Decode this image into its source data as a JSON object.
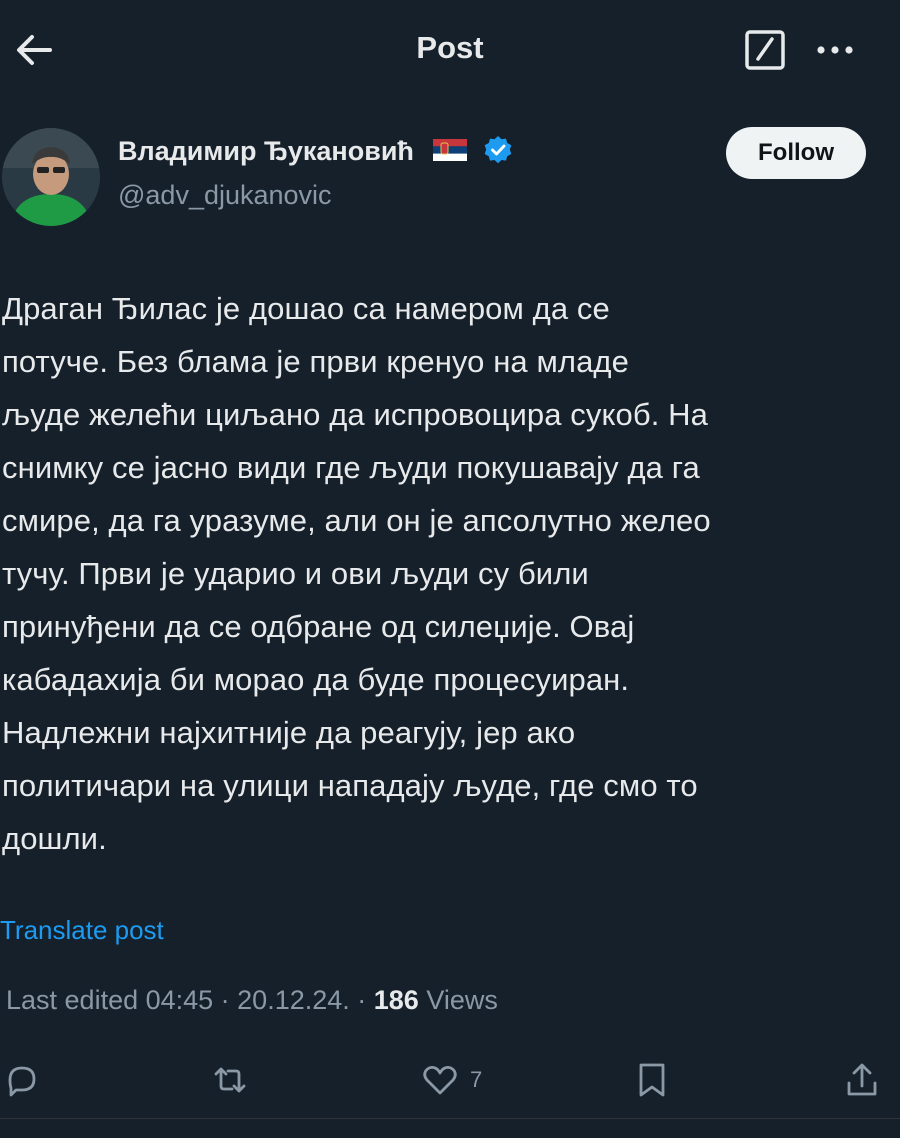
{
  "header": {
    "title": "Post"
  },
  "author": {
    "name": "Владимир Ђукановић",
    "handle": "@adv_djukanovic",
    "follow_label": "Follow"
  },
  "post": {
    "lines": [
      "Драган Ђилас је дошао са намером да се",
      "потуче. Без блама је први кренуо на младе",
      "људе желећи циљано да испровоцира сукоб. На",
      "снимку се јасно види где људи покушавају да га",
      "смире, да га уразуме, али он је апсолутно желео",
      "тучу. Први је ударио и ови људи су били",
      "принуђени да се одбране од силеџије. Овај",
      "кабадахија би морао да буде процесуиран.",
      "Надлежни најхитније да реагују, јер ако",
      "политичари на улици нападају људе, где смо то",
      "дошли."
    ],
    "translate_label": "Translate post",
    "meta_prefix": "Last edited 04:45 · 20.12.24.",
    "meta_sep": " · ",
    "views_count": "186",
    "views_label": " Views"
  },
  "actions": {
    "likes_count": "7"
  },
  "colors": {
    "background": "#15202b",
    "accent": "#1d9bf0",
    "muted": "#8b98a5"
  }
}
